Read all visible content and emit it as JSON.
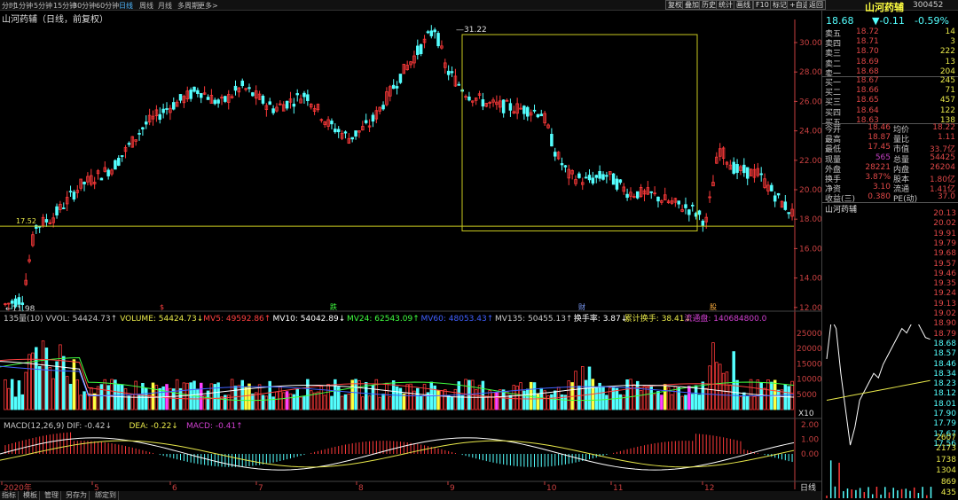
{
  "toolbar": {
    "periods": [
      "分时",
      "1分钟",
      "5分钟",
      "15分钟",
      "30分钟",
      "60分钟",
      "日线",
      "周线",
      "月线",
      "多周期",
      "更多>"
    ],
    "active_period": "日线",
    "right_buttons": [
      "复权",
      "叠加",
      "历史",
      "统计",
      "画线",
      "F10",
      "标记",
      "+自选",
      "返回"
    ]
  },
  "chart": {
    "title": "山河药辅（日线，前复权）",
    "high_label": "31.22",
    "low_label": "11.98",
    "hline_label": "17.52",
    "y_ticks": [
      "30.00",
      "28.00",
      "26.00",
      "24.00",
      "22.00",
      "20.00",
      "18.00",
      "16.00",
      "14.00",
      "12.00"
    ],
    "markers": [
      {
        "text": "$",
        "color": "#ff4040"
      },
      {
        "text": "跌",
        "color": "#40ff40"
      },
      {
        "text": "财",
        "color": "#80a0ff"
      },
      {
        "text": "股",
        "color": "#ffb040"
      }
    ]
  },
  "volume": {
    "header": [
      {
        "text": "135量(10) VVOL: 54424.73↑",
        "color": "#c8c8c8"
      },
      {
        "text": "VOLUME: 54424.73↓",
        "color": "#e8e84a"
      },
      {
        "text": "MV5: 49592.86↑",
        "color": "#ff4040"
      },
      {
        "text": "MV10: 54042.89↓",
        "color": "#ffffff"
      },
      {
        "text": "MV24: 62543.09↑",
        "color": "#40ff40"
      },
      {
        "text": "MV60: 48053.43↑",
        "color": "#4060ff"
      },
      {
        "text": "MV135: 50455.13↑",
        "color": "#c8c8c8"
      },
      {
        "text": "换手率: 3.87↓",
        "color": "#ffffff"
      },
      {
        "text": "累计换手: 38.41↓",
        "color": "#e8e84a"
      },
      {
        "text": "流通盘: 140684800.0",
        "color": "#d040d0"
      }
    ],
    "y_ticks": [
      "25000",
      "20000",
      "15000",
      "10000",
      "5000"
    ],
    "unit": "X10"
  },
  "macd": {
    "header": [
      {
        "text": "MACD(12,26,9) DIF: -0.42↓",
        "color": "#c8c8c8"
      },
      {
        "text": "DEA: -0.22↓",
        "color": "#e8e84a"
      },
      {
        "text": "MACD: -0.41↑",
        "color": "#d040d0"
      }
    ],
    "y_ticks": [
      "2.00",
      "1.00",
      "0.00"
    ]
  },
  "x_axis": {
    "labels": [
      "2020年",
      "5",
      "6",
      "7",
      "8",
      "9",
      "10",
      "11",
      "12"
    ],
    "period_label": "日线"
  },
  "bottom_tabs": [
    "指标",
    "模板",
    "管理",
    "另存为",
    "绑定到"
  ],
  "quote": {
    "name": "山河药辅",
    "code": "300452",
    "price": "18.68",
    "change": "▼-0.11",
    "pct": "-0.59%",
    "asks": [
      {
        "label": "卖五",
        "price": "18.72",
        "vol": "14"
      },
      {
        "label": "卖四",
        "price": "18.71",
        "vol": "3"
      },
      {
        "label": "卖三",
        "price": "18.70",
        "vol": "222"
      },
      {
        "label": "卖二",
        "price": "18.69",
        "vol": "13"
      },
      {
        "label": "卖一",
        "price": "18.68",
        "vol": "204"
      }
    ],
    "bids": [
      {
        "label": "买一",
        "price": "18.67",
        "vol": "245"
      },
      {
        "label": "买二",
        "price": "18.66",
        "vol": "71"
      },
      {
        "label": "买三",
        "price": "18.65",
        "vol": "457"
      },
      {
        "label": "买四",
        "price": "18.64",
        "vol": "122"
      },
      {
        "label": "买五",
        "price": "18.63",
        "vol": "138"
      }
    ],
    "stats": [
      {
        "l1": "今开",
        "v1": "18.46",
        "l2": "均价",
        "v2": "18.22"
      },
      {
        "l1": "最高",
        "v1": "18.87",
        "l2": "量比",
        "v2": "1.11"
      },
      {
        "l1": "最低",
        "v1": "17.45",
        "l2": "市值",
        "v2": "33.7亿"
      },
      {
        "l1": "现量",
        "v1": "565",
        "l2": "总量",
        "v2": "54425"
      },
      {
        "l1": "外盘",
        "v1": "28221",
        "l2": "内盘",
        "v2": "26204"
      },
      {
        "l1": "换手",
        "v1": "3.87%",
        "l2": "股本",
        "v2": "1.80亿"
      },
      {
        "l1": "净资",
        "v1": "3.10",
        "l2": "流通",
        "v2": "1.41亿"
      },
      {
        "l1": "收益(三)",
        "v1": "0.380",
        "l2": "PE(动)",
        "v2": "37.0"
      }
    ]
  },
  "intraday": {
    "title": "山河药辅",
    "price_ticks": [
      "20.13",
      "20.02",
      "19.91",
      "19.79",
      "19.68",
      "19.57",
      "19.46",
      "19.35",
      "19.24",
      "19.13",
      "19.02",
      "18.90",
      "18.79",
      "18.68",
      "18.57",
      "18.46",
      "18.34",
      "18.23",
      "18.12",
      "18.01",
      "17.90",
      "17.79",
      "17.67",
      "17.56"
    ],
    "vol_ticks": [
      "2607",
      "2173",
      "1738",
      "1304",
      "869",
      "435"
    ]
  }
}
